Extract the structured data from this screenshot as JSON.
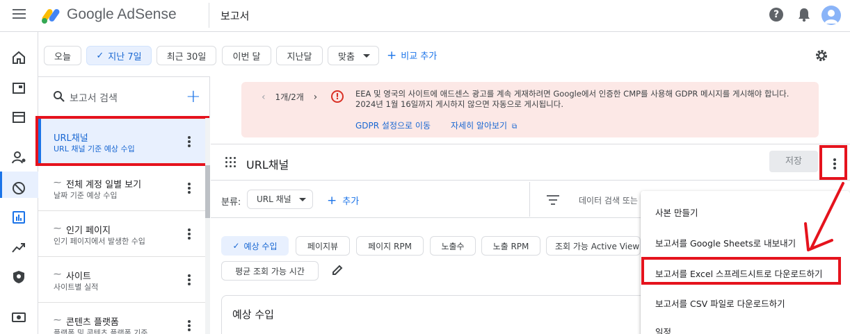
{
  "header": {
    "brand": "Google AdSense",
    "page_title": "보고서",
    "help_icon": "help-icon",
    "bell_icon": "notification-icon"
  },
  "rail": {
    "icons": [
      "home-icon",
      "ads-icon",
      "sites-icon",
      "account-icon",
      "block-icon",
      "reports-icon",
      "trending-icon",
      "privacy-icon",
      "payments-icon"
    ],
    "active": "reports-icon"
  },
  "filters": {
    "today": "오늘",
    "last7": "지난 7일",
    "last30": "최근 30일",
    "this_month": "이번 달",
    "last_month": "지난달",
    "custom": "맞춤",
    "add_compare": "비교 추가"
  },
  "sidebar": {
    "search_placeholder": "보고서 검색",
    "items": [
      {
        "title": "URL채널",
        "subtitle": "URL 채널 기준 예상 수입",
        "selected": true
      },
      {
        "title": "전체 계정 일별 보기",
        "subtitle": "날짜 기준 예상 수입"
      },
      {
        "title": "인기 페이지",
        "subtitle": "인기 페이지에서 발생한 수입"
      },
      {
        "title": "사이트",
        "subtitle": "사이트별 실적"
      },
      {
        "title": "콘텐츠 플랫폼",
        "subtitle": "플랫폼 및 콘텐츠 플랫폼 기준 ..."
      }
    ]
  },
  "alert": {
    "pager": "1개/2개",
    "message": "EEA 및 영국의 사이트에 애드센스 광고를 계속 게재하려면 Google에서 인증한 CMP를 사용해 GDPR 메시지를 게시해야 합니다. 2024년 1월 16일까지 게시하지 않으면 자동으로 게시됩니다.",
    "link1": "GDPR 설정으로 이동",
    "link2": "자세히 알아보기"
  },
  "report": {
    "title": "URL채널",
    "save": "저장",
    "breakdown_label": "분류:",
    "breakdown_value": "URL 채널",
    "add": "추가",
    "filter_placeholder": "데이터 검색 또는",
    "metrics": [
      "예상 수입",
      "페이지뷰",
      "페이지 RPM",
      "노출수",
      "노출 RPM",
      "조회 가능 Active View",
      "평균 조회 가능 시간"
    ],
    "card_title": "예상 수입"
  },
  "menu": {
    "items": [
      "사본 만들기",
      "보고서를 Google Sheets로 내보내기",
      "보고서를 Excel 스프레드시트로 다운로드하기",
      "보고서를 CSV 파일로 다운로드하기",
      "일정"
    ],
    "highlighted": 2
  },
  "annotation_color": "#e5131d"
}
